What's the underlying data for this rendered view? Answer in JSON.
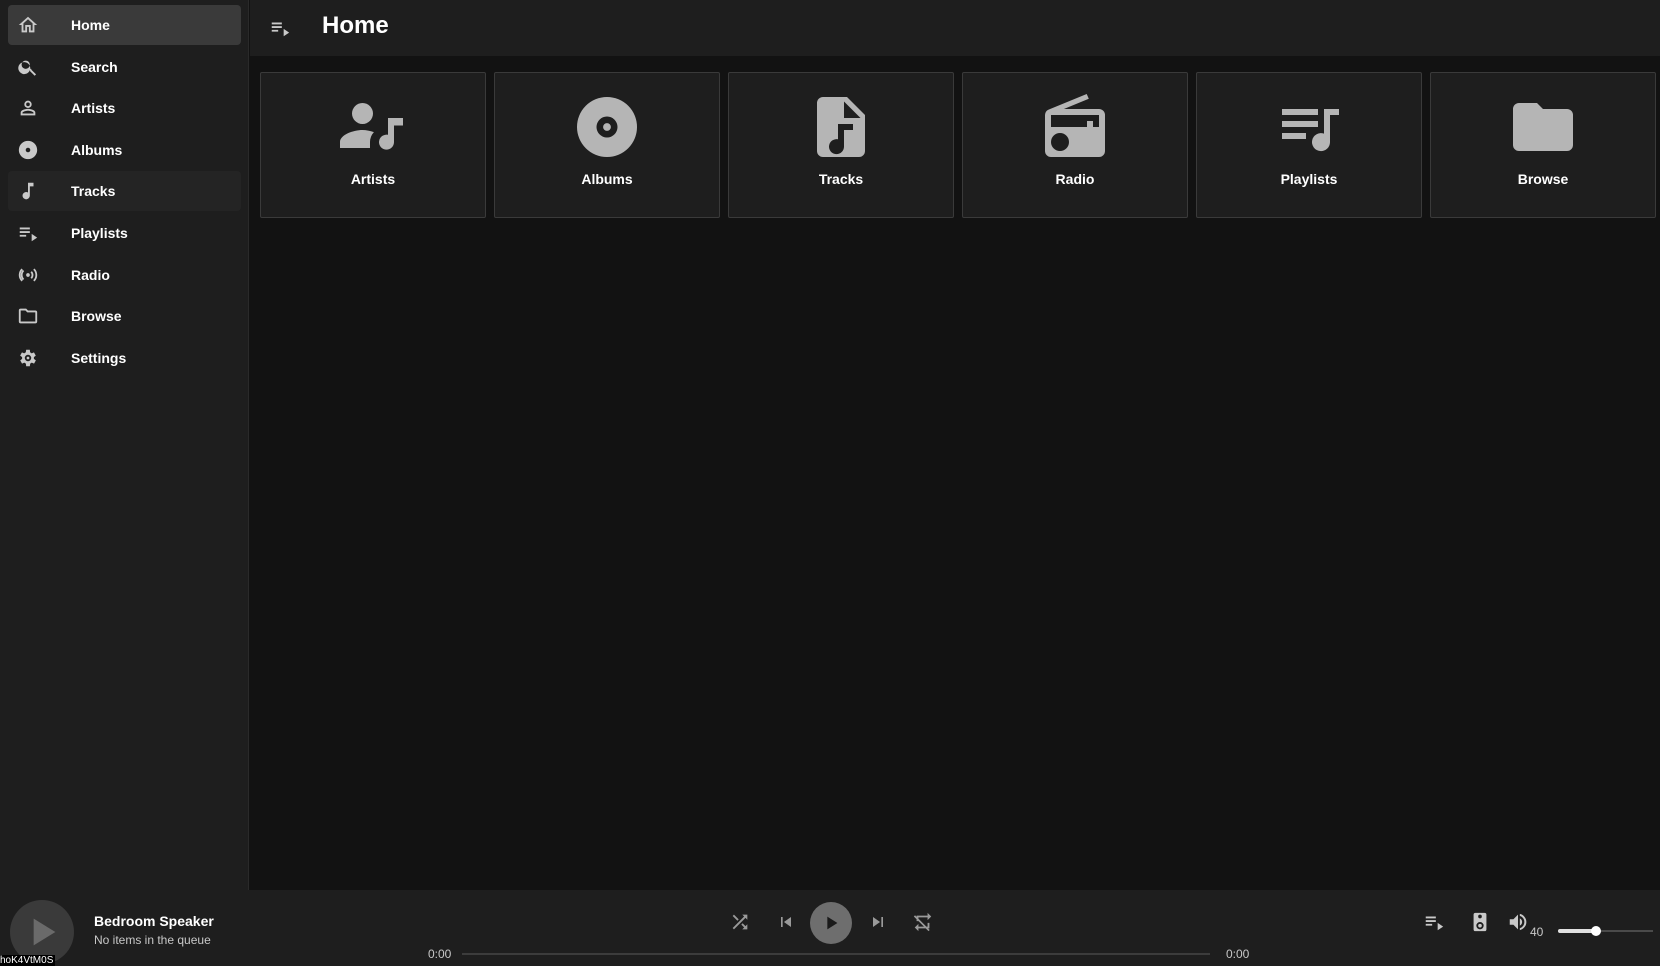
{
  "sidebar": {
    "items": [
      {
        "label": "Home",
        "icon": "home-icon"
      },
      {
        "label": "Search",
        "icon": "search-icon"
      },
      {
        "label": "Artists",
        "icon": "person-icon"
      },
      {
        "label": "Albums",
        "icon": "album-icon"
      },
      {
        "label": "Tracks",
        "icon": "music-note-icon"
      },
      {
        "label": "Playlists",
        "icon": "playlist-icon"
      },
      {
        "label": "Radio",
        "icon": "radio-waves-icon"
      },
      {
        "label": "Browse",
        "icon": "folder-icon"
      },
      {
        "label": "Settings",
        "icon": "gear-icon"
      }
    ],
    "active": "Home",
    "hovered": "Tracks"
  },
  "header": {
    "title": "Home",
    "menu_icon": "queue-list-icon"
  },
  "tiles": [
    {
      "label": "Artists",
      "icon": "artist-music-icon"
    },
    {
      "label": "Albums",
      "icon": "album-disc-icon"
    },
    {
      "label": "Tracks",
      "icon": "music-file-icon"
    },
    {
      "label": "Radio",
      "icon": "radio-icon"
    },
    {
      "label": "Playlists",
      "icon": "playlist-music-icon"
    },
    {
      "label": "Browse",
      "icon": "folder-icon"
    }
  ],
  "player": {
    "device_name": "Bedroom Speaker",
    "queue_status": "No items in the queue",
    "elapsed": "0:00",
    "duration": "0:00",
    "progress": 0,
    "volume": "40",
    "volume_fraction": 0.4
  },
  "corner_text": "hoK4VtM0S",
  "colors": {
    "background": "#121212",
    "surface": "#1e1e1e",
    "active_item": "#3a3a3a",
    "icon": "#b5b5b5",
    "text": "#ffffff"
  }
}
